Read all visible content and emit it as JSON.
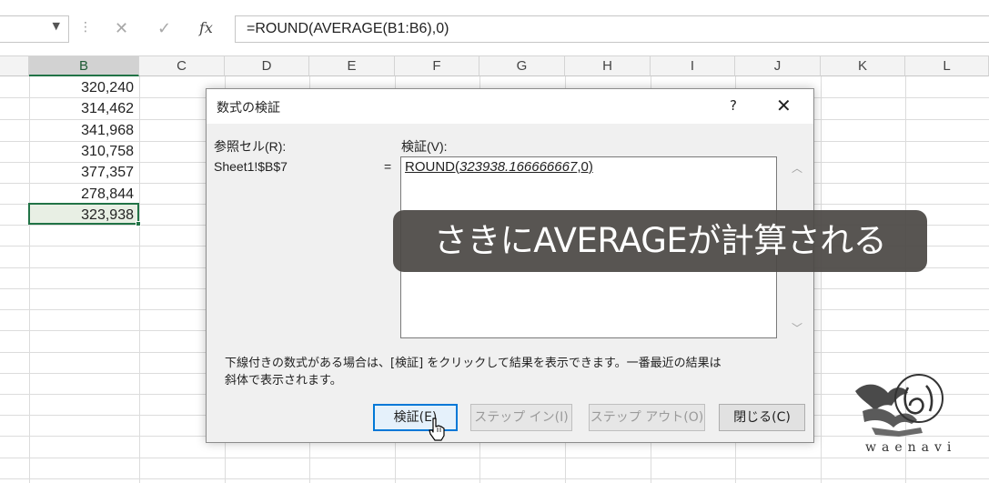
{
  "formula_bar": {
    "cancel_glyph": "✕",
    "enter_glyph": "✓",
    "fx_label": "fx",
    "formula": "=ROUND(AVERAGE(B1:B6),0)"
  },
  "columns": [
    "B",
    "C",
    "D",
    "E",
    "F",
    "G",
    "H",
    "I",
    "J",
    "K",
    "L"
  ],
  "cells": [
    "320,240",
    "314,462",
    "341,968",
    "310,758",
    "377,357",
    "278,844",
    "323,938"
  ],
  "dialog": {
    "title": "数式の検証",
    "help": "?",
    "close": "✕",
    "reference_label": "参照セル(R):",
    "reference_value": "Sheet1!$B$7",
    "equals": "=",
    "evaluation_label": "検証(V):",
    "evaluation_prefix": "ROUND(",
    "evaluation_italic": "323938.166666667",
    "evaluation_suffix": ",0)",
    "note_line1": "下線付きの数式がある場合は、[検証] をクリックして結果を表示できます。一番最近の結果は",
    "note_line2": "斜体で表示されます。",
    "buttons": {
      "evaluate": "検証(E)",
      "step_in": "ステップ イン(I)",
      "step_out": "ステップ アウト(O)",
      "close": "閉じる(C)"
    }
  },
  "caption": "さきにAVERAGEが計算される",
  "logo_text": "waenavi"
}
